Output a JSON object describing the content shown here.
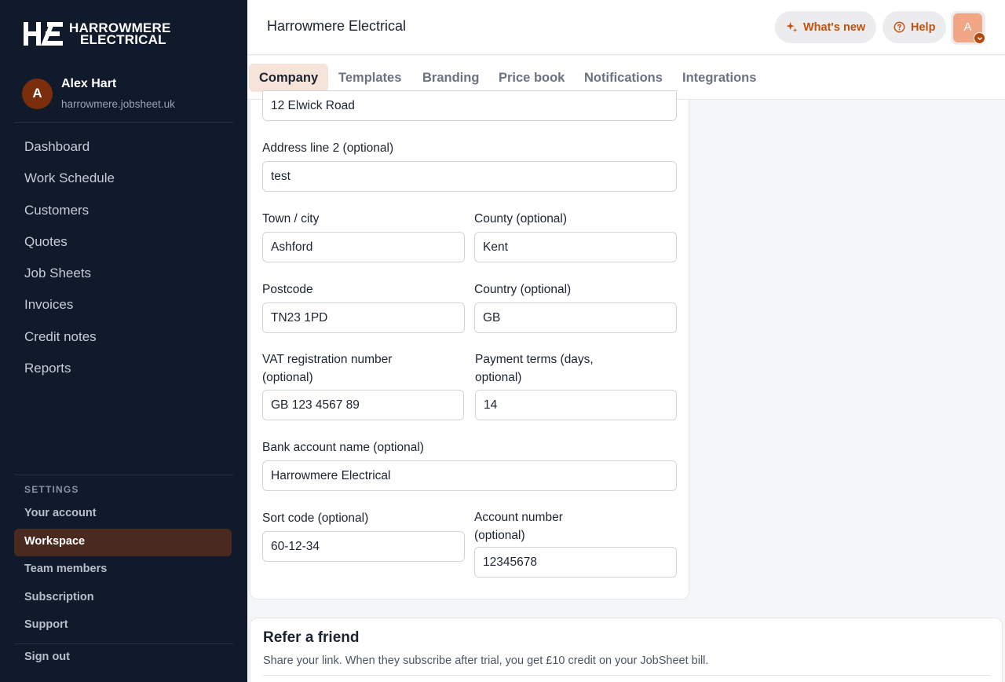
{
  "brand": {
    "line1": "HARROWMERE",
    "line2": "ELECTRICAL",
    "accent": "#c2500e"
  },
  "profile": {
    "initial": "A",
    "name": "Alex Hart",
    "domain": "harrowmere.jobsheet.uk"
  },
  "nav": [
    "Dashboard",
    "Work Schedule",
    "Customers",
    "Quotes",
    "Job Sheets",
    "Invoices",
    "Credit notes",
    "Reports"
  ],
  "settings": {
    "label": "SETTINGS",
    "items": [
      "Your account",
      "Workspace",
      "Team members",
      "Subscription",
      "Support"
    ],
    "active": "Workspace",
    "sign_out": "Sign out"
  },
  "header": {
    "title": "Harrowmere Electrical",
    "whats_new": "What's new",
    "help": "Help",
    "avatar_initial": "A"
  },
  "tabs": [
    "Company",
    "Templates",
    "Branding",
    "Price book",
    "Notifications",
    "Integrations"
  ],
  "active_tab": "Company",
  "form": {
    "address_line1_value": "12 Elwick Road",
    "address_line2": {
      "label": "Address line 2 (optional)",
      "value": "test"
    },
    "town": {
      "label": "Town / city",
      "value": "Ashford"
    },
    "county": {
      "label": "County (optional)",
      "value": "Kent"
    },
    "postcode": {
      "label": "Postcode",
      "value": "TN23 1PD"
    },
    "country": {
      "label": "Country (optional)",
      "value": "GB"
    },
    "vat": {
      "label_1": "VAT registration number",
      "label_2": "(optional)",
      "value": "GB 123 4567 89"
    },
    "payment_terms": {
      "label_1": "Payment terms (days,",
      "label_2": "optional)",
      "value": "14"
    },
    "bank_name": {
      "label": "Bank account name (optional)",
      "value": "Harrowmere Electrical"
    },
    "sort_code": {
      "label": "Sort code (optional)",
      "value": "60-12-34"
    },
    "account_number": {
      "label_1": "Account number",
      "label_2": "(optional)",
      "value": "12345678"
    }
  },
  "refer": {
    "title": "Refer a friend",
    "description": "Share your link. When they subscribe after trial, you get £10 credit on your JobSheet bill."
  }
}
